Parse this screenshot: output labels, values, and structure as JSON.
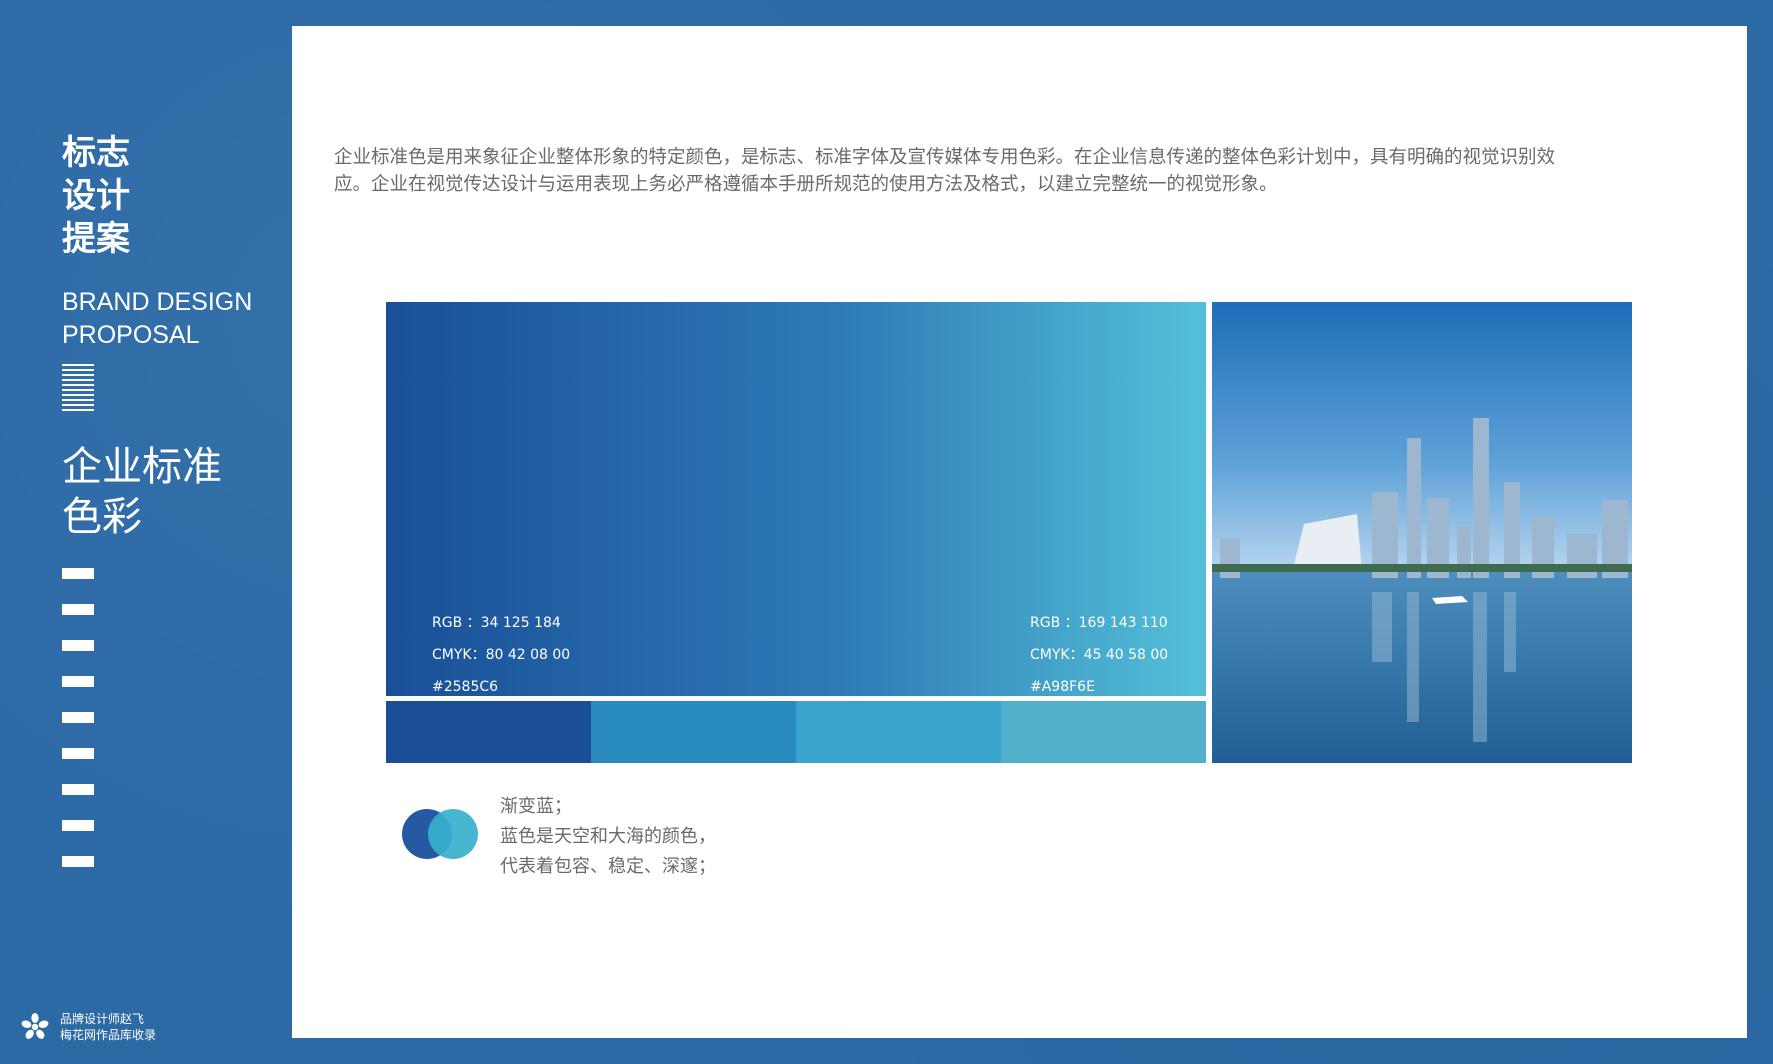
{
  "sidebar": {
    "title_lines": [
      "标志",
      "设计",
      "提案"
    ],
    "en_lines": [
      "BRAND DESIGN",
      "PROPOSAL"
    ],
    "section_lines": [
      "企业标准",
      "色彩"
    ],
    "footer_line1": "品牌设计师赵飞",
    "footer_line2": "梅花网作品库收录"
  },
  "intro_text": "企业标准色是用来象征企业整体形象的特定颜色，是标志、标准字体及宣传媒体专用色彩。在企业信息传递的整体色彩计划中，具有明确的视觉识别效应。企业在视觉传达设计与运用表现上务必严格遵循本手册所规范的使用方法及格式，以建立完整统一的视觉形象。",
  "colors": {
    "left": {
      "rgb": "RGB ：34 125 184",
      "cmyk": "CMYK：80 42 08 00",
      "hex": "#2585C6"
    },
    "right": {
      "rgb": "RGB ：169 143 110",
      "cmyk": "CMYK：45 40 58 00",
      "hex": "#A98F6E"
    }
  },
  "swatches": [
    "#1a4f98",
    "#2a8bc1",
    "#3aa3cb",
    "#52b0cd"
  ],
  "legend": {
    "line1": "渐变蓝；",
    "line2": "蓝色是天空和大海的颜色，",
    "line3": "代表着包容、稳定、深邃；"
  },
  "photo": {
    "icon": "city-skyline-river-photo"
  },
  "logo": {
    "icon": "flower-logo-icon"
  }
}
